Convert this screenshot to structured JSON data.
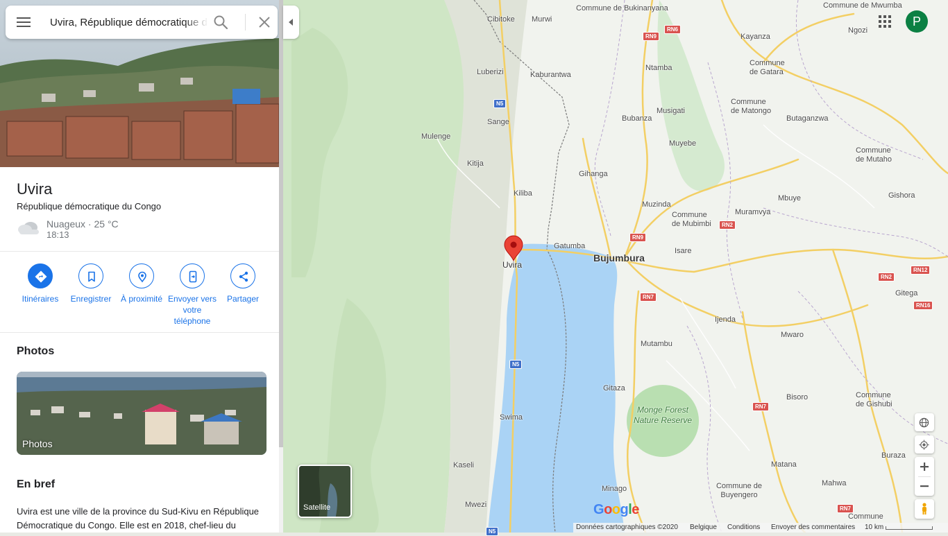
{
  "search": {
    "query": "Uvira, République démocratique du Congo"
  },
  "place": {
    "name": "Uvira",
    "country": "République démocratique du Congo",
    "weather": "Nuageux · 25 °C",
    "time": "18:13"
  },
  "actions": [
    {
      "label": "Itinéraires",
      "icon": "directions-icon"
    },
    {
      "label": "Enregistrer",
      "icon": "bookmark-icon"
    },
    {
      "label": "À proximité",
      "icon": "nearby-icon"
    },
    {
      "label": "Envoyer vers votre téléphone",
      "icon": "send-to-phone-icon"
    },
    {
      "label": "Partager",
      "icon": "share-icon"
    }
  ],
  "photos": {
    "heading": "Photos",
    "label": "Photos"
  },
  "summary": {
    "heading": "En bref",
    "text": "Uvira est une ville de la province du Sud-Kivu en République Démocratique du Congo. Elle est en 2018, chef-lieu du"
  },
  "user": {
    "initial": "P"
  },
  "map": {
    "cities": [
      {
        "name": "Bujumbura",
        "kind": "city"
      },
      {
        "name": "Uvira",
        "kind": "town"
      }
    ],
    "places": [
      "Commune de Bukinanyana",
      "Cibitoke",
      "Murwi",
      "Commune de Mwumba",
      "Ngozi",
      "Kayanza",
      "Luberizi",
      "Kaburantwa",
      "Ntamba",
      "Commune de Gatara",
      "Commune de Matongo",
      "Musigati",
      "Sange",
      "Bubanza",
      "Butaganzwa",
      "Mulenge",
      "Muyebe",
      "Kitija",
      "Gihanga",
      "Commune de Mutaho",
      "Kiliba",
      "Gishora",
      "Muzinda",
      "Mbuye",
      "Muramvya",
      "Commune de Mubimbi",
      "Gatumba",
      "Isare",
      "Gitega",
      "Ijenda",
      "Mwaro",
      "Mutambu",
      "Gitaza",
      "Bisoro",
      "Commune de Gishubi",
      "Swima",
      "Kaseli",
      "Matana",
      "Buraza",
      "Minago",
      "Mahwa",
      "Commune de Buyengero",
      "Mwezi",
      "Commune"
    ],
    "park": "Monge Forest Nature Reserve",
    "shields": [
      "RN9",
      "RN6",
      "N5",
      "RN2",
      "RN9",
      "RN12",
      "RN2",
      "RN7",
      "RN16",
      "N5",
      "RN7",
      "RN7",
      "N5"
    ],
    "satellite_label": "Satellite",
    "logo": "Google",
    "footer": {
      "data": "Données cartographiques ©2020",
      "country": "Belgique",
      "terms": "Conditions",
      "feedback": "Envoyer des commentaires",
      "scale": "10 km"
    }
  },
  "colors": {
    "accent": "#1a73e8",
    "water": "#aad3f5",
    "pin": "#ea4335",
    "road": "#f6d26b",
    "avatar": "#0b8043"
  }
}
